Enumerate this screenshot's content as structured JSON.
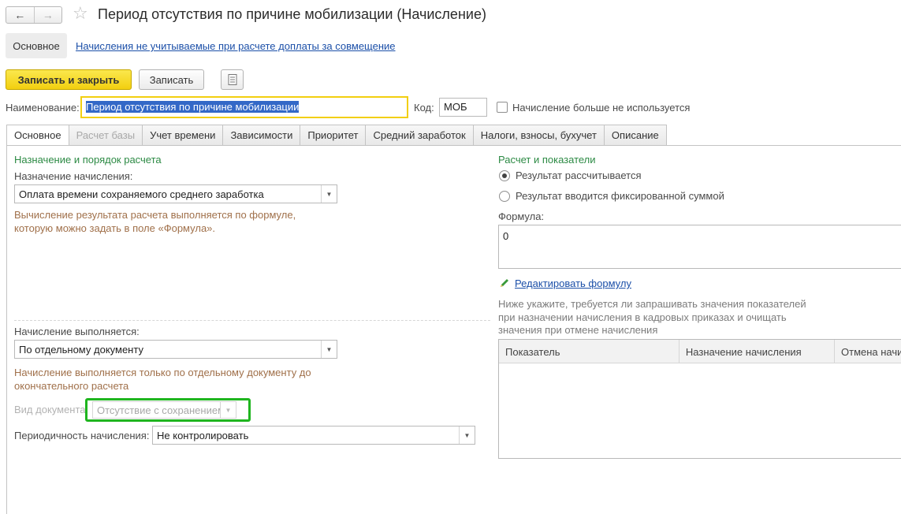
{
  "window": {
    "title": "Период отсутствия по причине мобилизации (Начисление)",
    "back_icon": "←",
    "forward_icon": "→",
    "favorite_icon": "☆"
  },
  "sections": {
    "main_label": "Основное",
    "link_label": "Начисления не учитываемые при расчете доплаты за совмещение"
  },
  "toolbar": {
    "save_close_label": "Записать и закрыть",
    "save_label": "Записать"
  },
  "header_fields": {
    "name_label": "Наименование:",
    "name_value": "Период отсутствия по причине мобилизации",
    "code_label": "Код:",
    "code_value": "МОБ",
    "not_used_label": "Начисление больше не используется"
  },
  "tabs": [
    {
      "label": "Основное"
    },
    {
      "label": "Расчет базы"
    },
    {
      "label": "Учет времени"
    },
    {
      "label": "Зависимости"
    },
    {
      "label": "Приоритет"
    },
    {
      "label": "Средний заработок"
    },
    {
      "label": "Налоги, взносы, бухучет"
    },
    {
      "label": "Описание"
    }
  ],
  "left": {
    "group_title": "Назначение и порядок расчета",
    "purpose_label": "Назначение начисления:",
    "purpose_value": "Оплата времени сохраняемого среднего заработка",
    "purpose_hint_1": "Вычисление результата расчета выполняется по формуле,",
    "purpose_hint_2": "которую можно задать в поле «Формула».",
    "performed_label": "Начисление выполняется:",
    "performed_value": "По отдельному документу",
    "performed_hint_1": "Начисление выполняется только по отдельному документу до",
    "performed_hint_2": "окончательного расчета",
    "doc_type_label": "Вид документа:",
    "doc_type_value": "Отсутствие с сохранением",
    "periodicity_label": "Периодичность начисления:",
    "periodicity_value": "Не контролировать"
  },
  "right": {
    "group_title": "Расчет и показатели",
    "radio_calculated": "Результат рассчитывается",
    "radio_fixed": "Результат вводится фиксированной суммой",
    "formula_label": "Формула:",
    "formula_value": "0",
    "edit_formula_link": "Редактировать формулу",
    "note_1": "Ниже укажите, требуется ли запрашивать значения показателей",
    "note_2": "при назначении начисления в кадровых приказах и очищать",
    "note_3": "значения при отмене начисления",
    "table_columns": [
      "Показатель",
      "Назначение начисления",
      "Отмена начи"
    ]
  },
  "colors": {
    "accent_yellow": "#f5d312",
    "highlight_green": "#1fb51f",
    "group_green": "#2c8a44",
    "link_blue": "#1b4fa8",
    "hint_brown": "#a0704a"
  }
}
